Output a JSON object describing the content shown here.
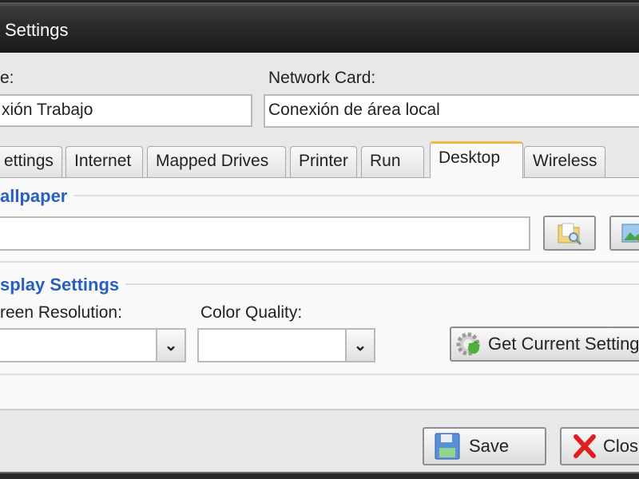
{
  "window": {
    "title": "Settings"
  },
  "connection": {
    "name_label": "e:",
    "name_value": "xión Trabajo",
    "network_card_label": "Network Card:",
    "network_card_value": "Conexión de área local"
  },
  "tabs": [
    {
      "label": "ettings"
    },
    {
      "label": "Internet"
    },
    {
      "label": "Mapped Drives"
    },
    {
      "label": "Printer"
    },
    {
      "label": "Run"
    },
    {
      "label": "Desktop",
      "active": true
    },
    {
      "label": "Wireless"
    }
  ],
  "wallpaper": {
    "heading": "allpaper",
    "path_value": "",
    "browse_icon": "folder-search-icon",
    "preview_icon": "image-icon"
  },
  "display": {
    "heading": "splay Settings",
    "resolution_label": "reen Resolution:",
    "resolution_value": "",
    "color_label": "Color Quality:",
    "color_value": "",
    "get_current_label": "Get Current Setting"
  },
  "footer": {
    "save_label": "Save",
    "close_label": "Clos"
  },
  "colors": {
    "accent": "#2a5fbf",
    "active_tab": "#f2b64a"
  }
}
